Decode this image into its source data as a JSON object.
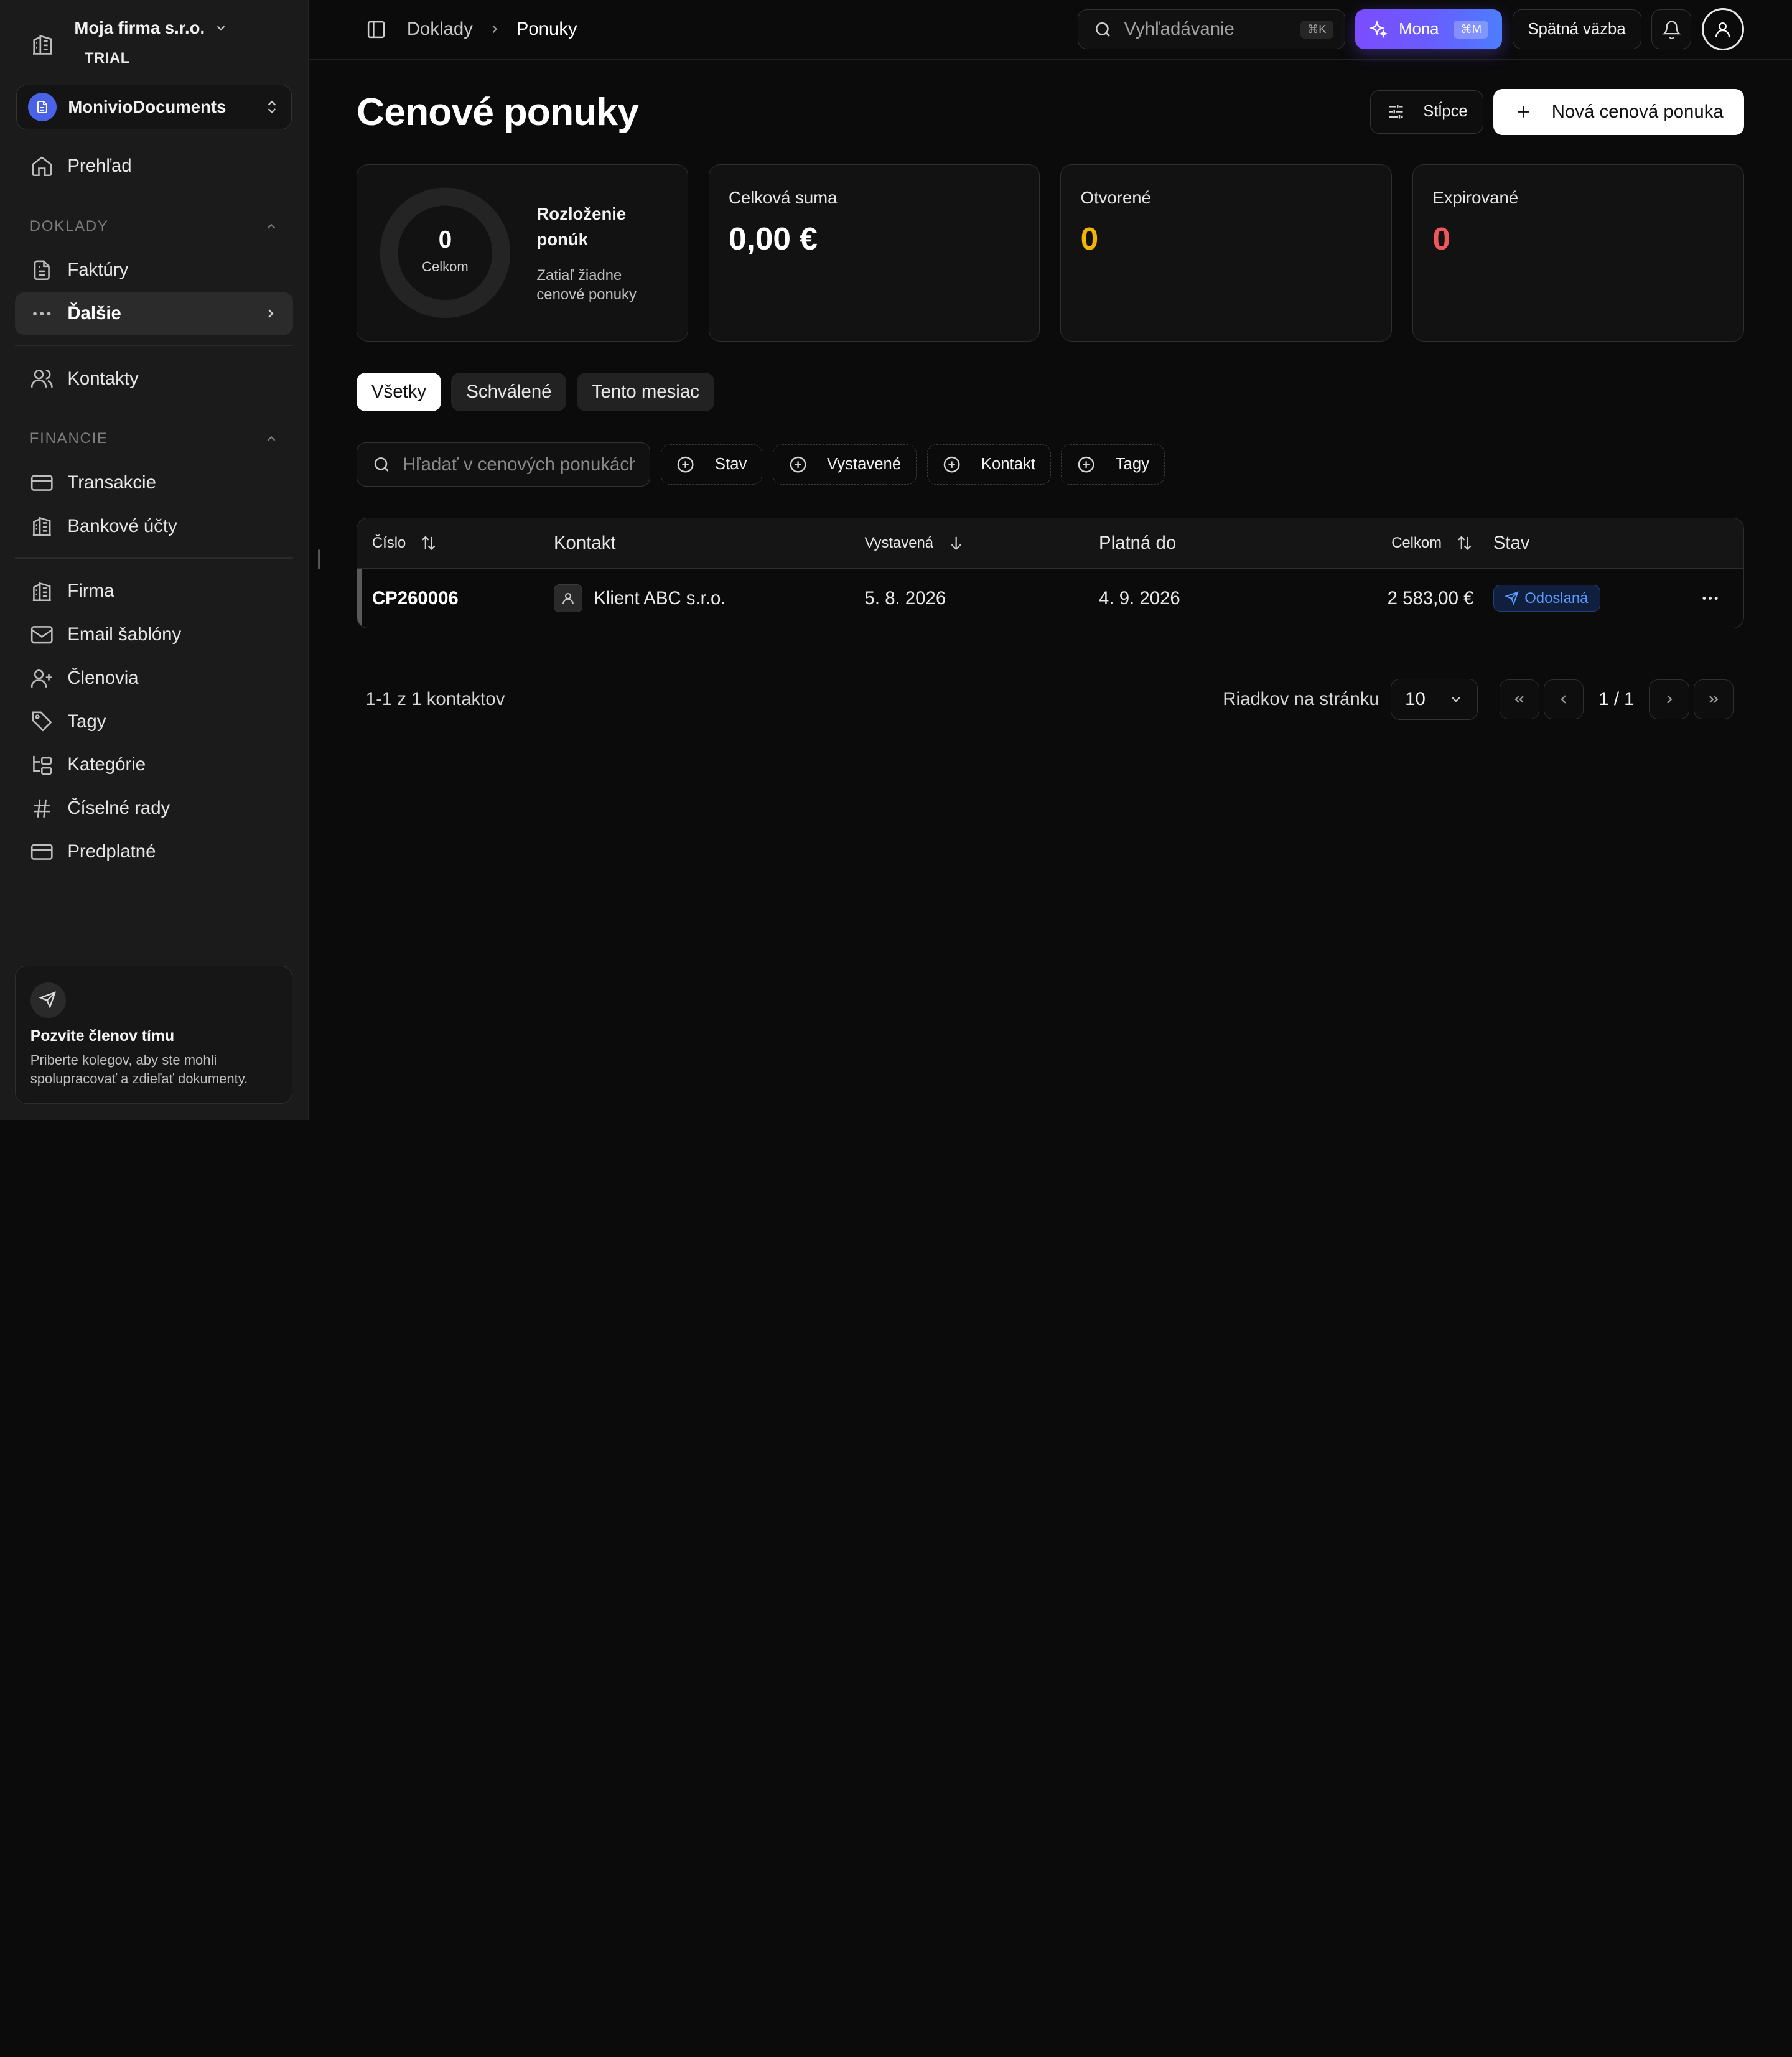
{
  "sidebar": {
    "org_name": "Moja firma s.r.o.",
    "org_plan": "TRIAL",
    "app_name": "MonivioDocuments",
    "overview_label": "Prehľad",
    "section_docs": "DOKLADY",
    "invoices_label": "Faktúry",
    "more_label": "Ďalšie",
    "contacts_label": "Kontakty",
    "section_finance": "FINANCIE",
    "transactions_label": "Transakcie",
    "bank_accounts_label": "Bankové účty",
    "company_label": "Firma",
    "email_templates_label": "Email šablóny",
    "members_label": "Členovia",
    "tags_label": "Tagy",
    "categories_label": "Kategórie",
    "number_series_label": "Číselné rady",
    "subscription_label": "Predplatné",
    "invite": {
      "title": "Pozvite členov tímu",
      "desc": "Priberte kolegov, aby ste mohli spolupracovať a zdieľať dokumenty."
    }
  },
  "topbar": {
    "breadcrumb_root": "Doklady",
    "breadcrumb_current": "Ponuky",
    "search_placeholder": "Vyhľadávanie",
    "search_shortcut": "⌘K",
    "mona_label": "Mona",
    "mona_shortcut": "⌘M",
    "feedback_label": "Spätná väzba"
  },
  "page": {
    "title": "Cenové ponuky",
    "columns_label": "Stĺpce",
    "new_quote_label": "Nová cenová ponuka"
  },
  "stats": {
    "donut_total": "0",
    "donut_sub": "Celkom",
    "donut_title": "Rozloženie ponúk",
    "donut_desc": "Zatiaľ žiadne cenové ponuky",
    "total_sum_label": "Celková suma",
    "total_sum_value": "0,00 €",
    "open_label": "Otvorené",
    "open_value": "0",
    "expired_label": "Expirované",
    "expired_value": "0",
    "open_color": "#f5b400",
    "expired_color": "#f0575c"
  },
  "tabs": {
    "all": "Všetky",
    "approved": "Schválené",
    "this_month": "Tento mesiac"
  },
  "filters": {
    "search_placeholder": "Hľadať v cenových ponukách",
    "status": "Stav",
    "issued": "Vystavené",
    "contact": "Kontakt",
    "tags": "Tagy"
  },
  "table": {
    "headers": {
      "number": "Číslo",
      "contact": "Kontakt",
      "issued": "Vystavená",
      "valid_until": "Platná do",
      "total": "Celkom",
      "status": "Stav"
    },
    "rows": [
      {
        "number": "CP260006",
        "contact": "Klient ABC s.r.o.",
        "issued": "5. 8. 2026",
        "valid_until": "4. 9. 2026",
        "total": "2 583,00 €",
        "status": "Odoslaná"
      }
    ]
  },
  "pagination": {
    "count_text": "1-1 z 1 kontaktov",
    "rows_per_page_label": "Riadkov na stránku",
    "rows_per_page_value": "10",
    "page_indicator": "1 / 1"
  }
}
